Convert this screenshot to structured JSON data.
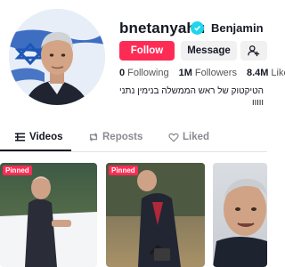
{
  "profile": {
    "username": "bnetanyahu",
    "display_name": "Benjamin Netanyahu",
    "follow_label": "Follow",
    "message_label": "Message",
    "stats": {
      "following_count": "0",
      "following_label": "Following",
      "followers_count": "1M",
      "followers_label": "Followers",
      "likes_count": "8.4M",
      "likes_label": "Likes"
    },
    "bio_line1": "הטיקטוק של ראש הממשלה בנימין נתניהו -",
    "bio_line2": "ווווו"
  },
  "tabs": [
    {
      "label": "Videos",
      "icon": "grid-lines-icon"
    },
    {
      "label": "Reposts",
      "icon": "repost-icon"
    },
    {
      "label": "Liked",
      "icon": "heart-icon"
    }
  ],
  "videos": [
    {
      "badge": "Pinned"
    },
    {
      "badge": "Pinned"
    },
    {
      "badge": ""
    }
  ],
  "colors": {
    "accent": "#fe2c55",
    "verified": "#20d5ec",
    "text": "#161823",
    "muted": "#8a8b91"
  }
}
